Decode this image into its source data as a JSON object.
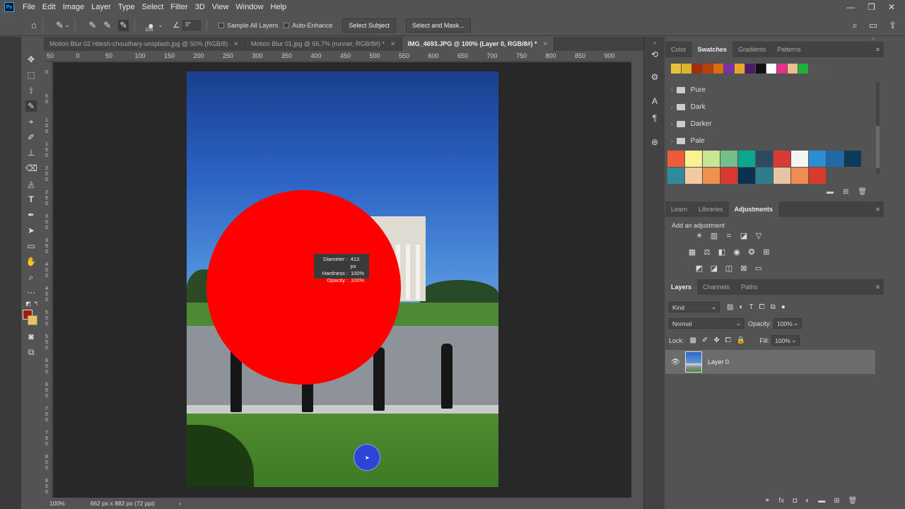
{
  "menu": {
    "logo": "Ps",
    "items": [
      "File",
      "Edit",
      "Image",
      "Layer",
      "Type",
      "Select",
      "Filter",
      "3D",
      "View",
      "Window",
      "Help"
    ],
    "window_controls": [
      "—",
      "❐",
      "✕"
    ]
  },
  "options_bar": {
    "brush_size": "105",
    "angle": "0°",
    "sample_all_layers": "Sample All Layers",
    "auto_enhance": "Auto-Enhance",
    "select_subject": "Select Subject",
    "select_and_mask": "Select and Mask..."
  },
  "tabs": [
    {
      "label": "Motion Blur 02 Hitesh-choudhary-unsplash.jpg @ 50% (RGB/8)",
      "close": "✕"
    },
    {
      "label": "Motion Blur 01.jpg @ 66.7% (runner, RGB/8#) *",
      "close": "✕"
    },
    {
      "label": "IMG_4693.JPG @ 100% (Layer 0, RGB/8#) *",
      "close": "✕"
    }
  ],
  "ruler": {
    "h_labels": [
      "50",
      "0",
      "50",
      "100",
      "150",
      "200",
      "250",
      "300",
      "350",
      "400",
      "450",
      "500",
      "550",
      "600",
      "650",
      "700",
      "750",
      "800",
      "850",
      "900"
    ],
    "v_labels": [
      "0",
      "5 0",
      "1 0 0",
      "1 5 0",
      "2 0 0",
      "2 5 0",
      "3 0 0",
      "3 5 0",
      "4 0 0",
      "4 5 0",
      "5 0 0",
      "5 5 0",
      "6 0 0",
      "6 5 0",
      "7 0 0",
      "7 5 0",
      "8 0 0",
      "8 5 0"
    ]
  },
  "brush_tooltip": {
    "diameter_label": "Diameter :",
    "diameter_value": "413 px",
    "hardness_label": "Hardness :",
    "hardness_value": "100%",
    "opacity_label": "Opacity :",
    "opacity_value": "100%"
  },
  "status": {
    "zoom": "100%",
    "doc_info": "662 px x 882 px (72 ppi)",
    "arrow": "›"
  },
  "colors": {
    "foreground": "#a01b05",
    "background": "#e8c35a",
    "brush_fill": "#ff0000"
  },
  "swatches_panel": {
    "tabs": [
      "Color",
      "Swatches",
      "Gradients",
      "Patterns"
    ],
    "recent": [
      "#e8c33a",
      "#e0b32c",
      "#a52d0c",
      "#b8400c",
      "#d96d0f",
      "#7b2fa8",
      "#e8a72c",
      "#4c1a6e",
      "#111111",
      "#ffffff",
      "#e8308a",
      "#e8c090",
      "#1db23a",
      "#555555",
      "#555555"
    ],
    "folders": [
      "Pure",
      "Dark",
      "Darker",
      "Pale"
    ],
    "grid": [
      "#f05a3a",
      "#f8f294",
      "#c6e694",
      "#74c08a",
      "#0aa88c",
      "#2e4a62",
      "#d93a36",
      "#f4f4f4",
      "#2c8fd6",
      "#1e6aa8",
      "#0c3a5a",
      "#2e8a9c",
      "#f2c9a0",
      "#f0904c",
      "#d83a30",
      "#0c3050",
      "#2e7c8c",
      "#e6c4a6",
      "#ee8c52",
      "#d63c2c"
    ]
  },
  "adjustments_panel": {
    "tabs": [
      "Learn",
      "Libraries",
      "Adjustments"
    ],
    "label": "Add an adjustment"
  },
  "layers_panel": {
    "tabs": [
      "Layers",
      "Channels",
      "Paths"
    ],
    "kind": "Kind",
    "blend_mode": "Normal",
    "opacity_label": "Opacity:",
    "opacity_value": "100%",
    "lock_label": "Lock:",
    "fill_label": "Fill:",
    "fill_value": "100%",
    "layers": [
      {
        "name": "Layer 0"
      }
    ]
  }
}
